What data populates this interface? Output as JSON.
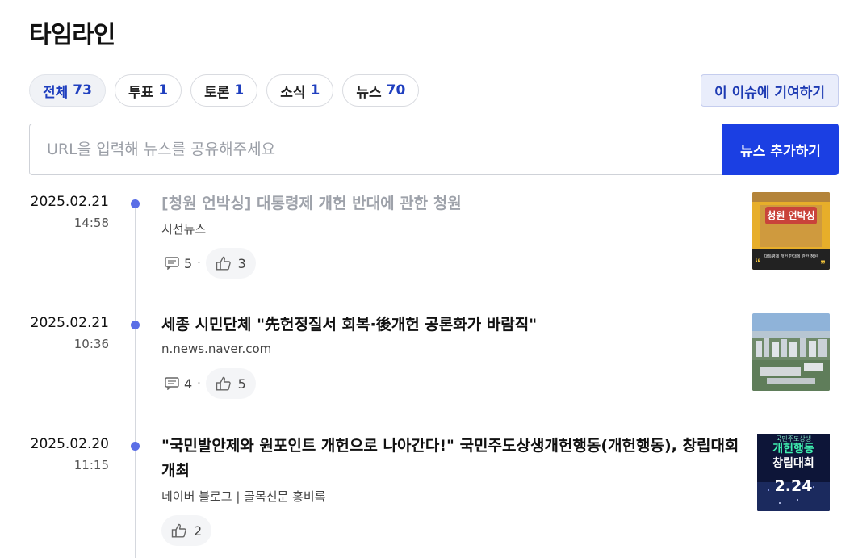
{
  "page": {
    "title": "타임라인"
  },
  "filters": [
    {
      "label": "전체",
      "count": "73"
    },
    {
      "label": "투표",
      "count": "1"
    },
    {
      "label": "토론",
      "count": "1"
    },
    {
      "label": "소식",
      "count": "1"
    },
    {
      "label": "뉴스",
      "count": "70"
    }
  ],
  "contribute_label": "이 이슈에 기여하기",
  "url_input": {
    "placeholder": "URL을 입력해 뉴스를 공유해주세요",
    "value": ""
  },
  "add_button_label": "뉴스 추가하기",
  "items": [
    {
      "date": "2025.02.21",
      "time": "14:58",
      "headline": "[청원 언박싱] 대통령제 개헌 반대에 관한 청원",
      "source": "시선뉴스",
      "comments": "5",
      "likes": "3",
      "sep": "·",
      "thumb_title": "청원 언박싱",
      "thumb_caption": "대통령제 개헌 반대에 관한 청원"
    },
    {
      "date": "2025.02.21",
      "time": "10:36",
      "headline": "세종 시민단체 \"先헌정질서 회복·後개헌 공론화가 바람직\"",
      "source": "n.news.naver.com",
      "comments": "4",
      "likes": "5",
      "sep": "·"
    },
    {
      "date": "2025.02.20",
      "time": "11:15",
      "headline": "\"국민발안제와 원포인트 개헌으로 나아간다!\" 국민주도상생개헌행동(개헌행동), 창립대회 개최",
      "source": "네이버 블로그 | 골목신문 홍비록",
      "likes": "2",
      "thumb_top": "국민주도상생",
      "thumb_title1": "개헌행동",
      "thumb_title2": "창립대회",
      "thumb_big": "2.24"
    }
  ],
  "colors": {
    "accent": "#1b3fe3",
    "dot": "#5a6ee6",
    "count": "#1f3fbf"
  }
}
